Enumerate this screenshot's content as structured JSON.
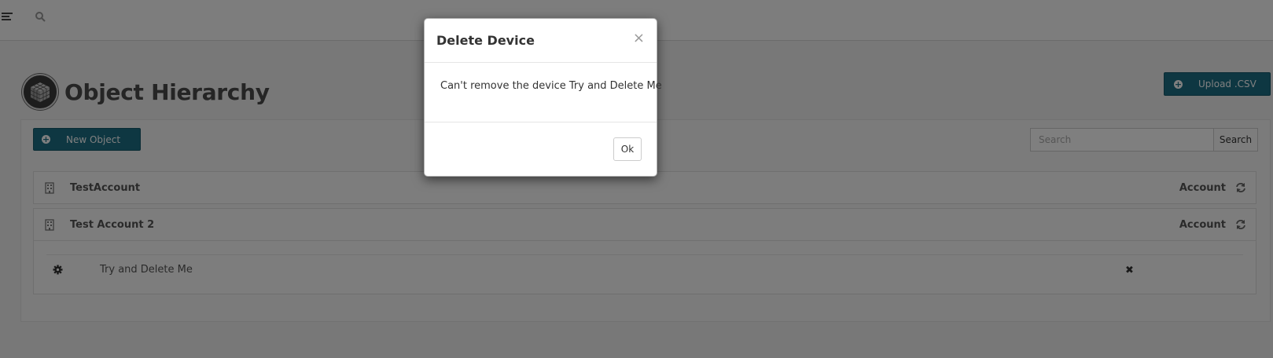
{
  "topbar": {
    "menu_icon": "menu-icon",
    "search_icon": "search-icon"
  },
  "page": {
    "title": "Object Hierarchy",
    "logo_icon": "cube-icon"
  },
  "toolbar": {
    "upload_label": "Upload .CSV",
    "new_object_label": "New Object",
    "search_placeholder": "Search",
    "search_button_label": "Search",
    "accent_color": "#1d6f84"
  },
  "rows": [
    {
      "name": "TestAccount",
      "type": "Account",
      "icon": "building-icon",
      "action_icon": "refresh-icon"
    },
    {
      "name": "Test Account 2",
      "type": "Account",
      "icon": "building-icon",
      "action_icon": "refresh-icon",
      "children": [
        {
          "name": "Try and Delete Me",
          "icon": "gear-icon",
          "action_icon": "remove-icon"
        }
      ]
    }
  ],
  "modal": {
    "title": "Delete Device",
    "close_label": "×",
    "message": "Can't remove the device Try and Delete Me",
    "ok_label": "Ok"
  }
}
